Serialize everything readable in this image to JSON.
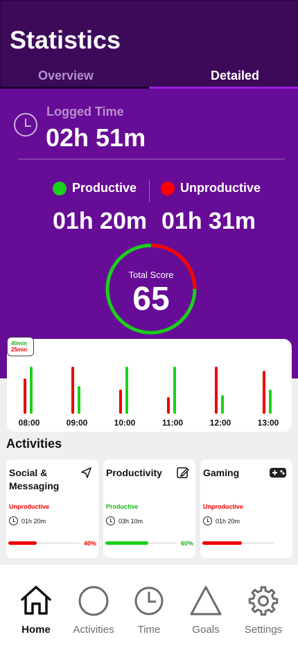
{
  "header": {
    "title": "Statistics",
    "tabs": [
      {
        "label": "Overview",
        "active": false
      },
      {
        "label": "Detailed",
        "active": true
      }
    ]
  },
  "logged": {
    "label": "Logged Time",
    "value": "02h 51m"
  },
  "split": {
    "productive": {
      "label": "Productive",
      "value": "01h 20m",
      "color": "#1bd01b"
    },
    "unproductive": {
      "label": "Unproductive",
      "value": "01h 31m",
      "color": "#ff0000"
    }
  },
  "score": {
    "label": "Total Score",
    "value": "65",
    "productive_fraction": 0.75
  },
  "chart_data": {
    "type": "bar",
    "legend": {
      "productive": "40min",
      "unproductive": "25min"
    },
    "categories": [
      "08:00",
      "09:00",
      "10:00",
      "11:00",
      "12:00",
      "13:00"
    ],
    "series": [
      {
        "name": "Unproductive",
        "color": "#e00000",
        "values": [
          28,
          37,
          19,
          13,
          37,
          34
        ]
      },
      {
        "name": "Productive",
        "color": "#1bd01b",
        "values": [
          37,
          22,
          37,
          37,
          15,
          19
        ]
      }
    ],
    "ylim": [
      0,
      40
    ]
  },
  "activities": {
    "title": "Activities",
    "items": [
      {
        "name": "Social & Messaging",
        "icon": "send-icon",
        "status": "Unproductive",
        "time": "01h 20m",
        "percent_label": "40%",
        "percent": 0.4
      },
      {
        "name": "Productivity",
        "icon": "edit-icon",
        "status": "Productive",
        "time": "03h 10m",
        "percent_label": "60%",
        "percent": 0.6
      },
      {
        "name": "Gaming",
        "icon": "gamepad-icon",
        "status": "Unproductive",
        "time": "01h 20m",
        "percent_label": "",
        "percent": 0.55
      }
    ]
  },
  "nav": {
    "items": [
      {
        "label": "Home",
        "icon": "home-icon",
        "active": true
      },
      {
        "label": "Activities",
        "icon": "circle-icon",
        "active": false
      },
      {
        "label": "Time",
        "icon": "clock-icon",
        "active": false
      },
      {
        "label": "Goals",
        "icon": "triangle-icon",
        "active": false
      },
      {
        "label": "Settings",
        "icon": "gear-icon",
        "active": false
      }
    ]
  }
}
